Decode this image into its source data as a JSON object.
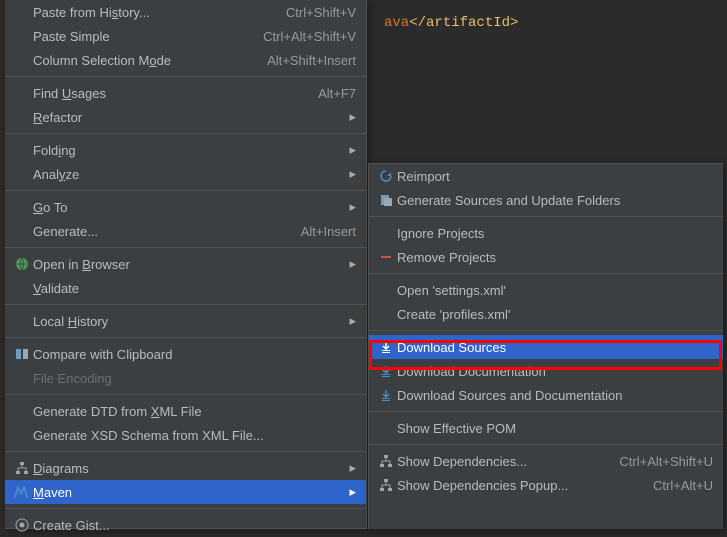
{
  "editor": {
    "code_visible": "ava</artifactId>"
  },
  "primaryMenu": {
    "items": [
      {
        "label": "Paste from History...",
        "shortcut": "Ctrl+Shift+V",
        "icon": null,
        "arrow": false,
        "underlineIdx": 13
      },
      {
        "label": "Paste Simple",
        "shortcut": "Ctrl+Alt+Shift+V",
        "icon": null,
        "arrow": false
      },
      {
        "label": "Column Selection Mode",
        "shortcut": "Alt+Shift+Insert",
        "icon": null,
        "arrow": false,
        "underlineIdx": 18
      },
      {
        "sep": true
      },
      {
        "label": "Find Usages",
        "shortcut": "Alt+F7",
        "icon": null,
        "arrow": false,
        "underlineIdx": 5
      },
      {
        "label": "Refactor",
        "shortcut": "",
        "icon": null,
        "arrow": true,
        "underlineIdx": 0
      },
      {
        "sep": true
      },
      {
        "label": "Folding",
        "shortcut": "",
        "icon": null,
        "arrow": true,
        "underlineIdx": 4
      },
      {
        "label": "Analyze",
        "shortcut": "",
        "icon": null,
        "arrow": true,
        "underlineIdx": 4
      },
      {
        "sep": true
      },
      {
        "label": "Go To",
        "shortcut": "",
        "icon": null,
        "arrow": true,
        "underlineIdx": 0
      },
      {
        "label": "Generate...",
        "shortcut": "Alt+Insert",
        "icon": null,
        "arrow": false
      },
      {
        "sep": true
      },
      {
        "label": "Open in Browser",
        "shortcut": "",
        "icon": "browser",
        "arrow": true,
        "underlineIdx": 8
      },
      {
        "label": "Validate",
        "shortcut": "",
        "icon": null,
        "arrow": false,
        "underlineIdx": 0
      },
      {
        "sep": true
      },
      {
        "label": "Local History",
        "shortcut": "",
        "icon": null,
        "arrow": true,
        "underlineIdx": 6
      },
      {
        "sep": true
      },
      {
        "label": "Compare with Clipboard",
        "shortcut": "",
        "icon": "compare",
        "arrow": false,
        "underlineIdx": 22
      },
      {
        "label": "File Encoding",
        "shortcut": "",
        "icon": null,
        "arrow": false,
        "disabled": true
      },
      {
        "sep": true
      },
      {
        "label": "Generate DTD from XML File",
        "shortcut": "",
        "icon": null,
        "arrow": false,
        "underlineIdx": 18
      },
      {
        "label": "Generate XSD Schema from XML File...",
        "shortcut": "",
        "icon": null,
        "arrow": false
      },
      {
        "sep": true
      },
      {
        "label": "Diagrams",
        "shortcut": "",
        "icon": "diagrams",
        "arrow": true,
        "underlineIdx": 0
      },
      {
        "label": "Maven",
        "shortcut": "",
        "icon": "maven",
        "arrow": true,
        "selected": true,
        "underlineIdx": 0
      },
      {
        "sep": true
      },
      {
        "label": "Create Gist...",
        "shortcut": "",
        "icon": "gist",
        "arrow": false
      }
    ]
  },
  "secondaryMenu": {
    "items": [
      {
        "label": "Reimport",
        "shortcut": "",
        "icon": "reimport",
        "arrow": false
      },
      {
        "label": "Generate Sources and Update Folders",
        "shortcut": "",
        "icon": "generate-sources",
        "arrow": false
      },
      {
        "sep": true
      },
      {
        "label": "Ignore Projects",
        "shortcut": "",
        "icon": null,
        "arrow": false
      },
      {
        "label": "Remove Projects",
        "shortcut": "",
        "icon": "remove",
        "arrow": false
      },
      {
        "sep": true
      },
      {
        "label": "Open 'settings.xml'",
        "shortcut": "",
        "icon": null,
        "arrow": false
      },
      {
        "label": "Create 'profiles.xml'",
        "shortcut": "",
        "icon": null,
        "arrow": false
      },
      {
        "sep": true
      },
      {
        "label": "Download Sources",
        "shortcut": "",
        "icon": "download",
        "arrow": false,
        "selected": true,
        "highlighted": true
      },
      {
        "label": "Download Documentation",
        "shortcut": "",
        "icon": "download",
        "arrow": false
      },
      {
        "label": "Download Sources and Documentation",
        "shortcut": "",
        "icon": "download",
        "arrow": false
      },
      {
        "sep": true
      },
      {
        "label": "Show Effective POM",
        "shortcut": "",
        "icon": null,
        "arrow": false
      },
      {
        "sep": true
      },
      {
        "label": "Show Dependencies...",
        "shortcut": "Ctrl+Alt+Shift+U",
        "icon": "diagrams",
        "arrow": false
      },
      {
        "label": "Show Dependencies Popup...",
        "shortcut": "Ctrl+Alt+U",
        "icon": "diagrams",
        "arrow": false
      }
    ]
  },
  "colors": {
    "selection": "#2f65ca",
    "highlight_border": "#ff0000"
  }
}
